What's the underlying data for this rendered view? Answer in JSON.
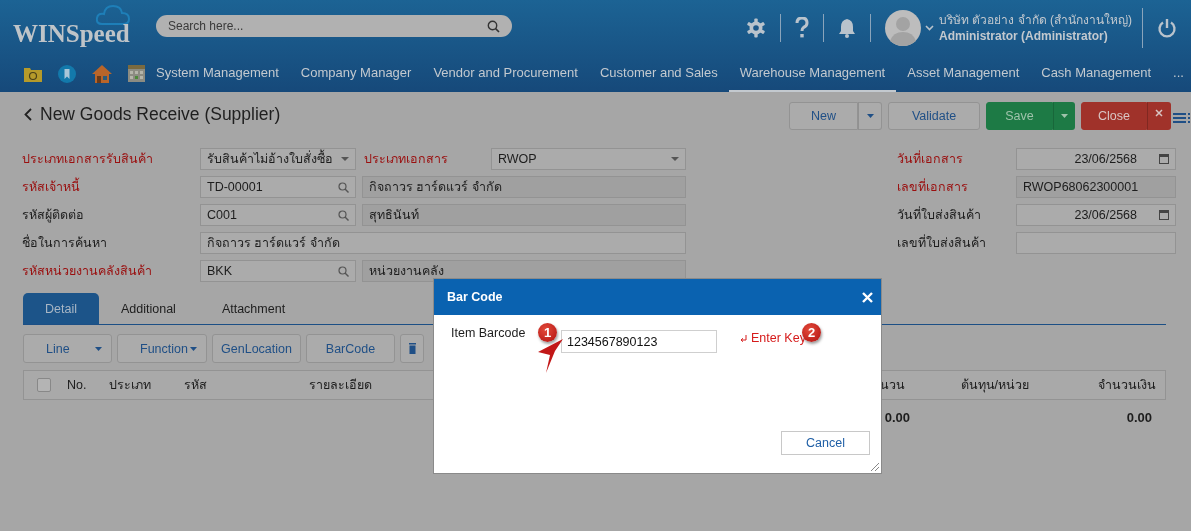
{
  "app": {
    "logo": "WINSpeed",
    "search": {
      "placeholder": "Search here..."
    },
    "user": {
      "company": "บริษัท ตัวอย่าง จำกัด (สำนักงานใหญ่)",
      "name": "Administrator (Administrator)"
    }
  },
  "nav": [
    {
      "label": "System Management",
      "selected": false
    },
    {
      "label": "Company Manager",
      "selected": false
    },
    {
      "label": "Vendor and Procurement",
      "selected": false
    },
    {
      "label": "Customer and Sales",
      "selected": false
    },
    {
      "label": "Warehouse Management",
      "selected": true
    },
    {
      "label": "Asset Management",
      "selected": false
    },
    {
      "label": "Cash Management",
      "selected": false
    }
  ],
  "nav_more": "...",
  "page": {
    "title": "New Goods Receive (Supplier)"
  },
  "actions": [
    {
      "label": "New",
      "kind": "split"
    },
    {
      "label": "Validate",
      "kind": "plain"
    },
    {
      "label": "Save",
      "kind": "confirm"
    },
    {
      "label": "Close",
      "kind": "closable"
    }
  ],
  "form_left": [
    {
      "label": "ประเภทเอกสารรับสินค้า",
      "required": true,
      "fields": [
        {
          "kind": "select",
          "value": "รับสินค้าไม่อ้างใบสั่งซื้อ"
        },
        {
          "kind": "label",
          "value": "ประเภทเอกสาร",
          "required": true
        },
        {
          "kind": "select",
          "value": "RWOP"
        }
      ]
    },
    {
      "label": "รหัสเจ้าหนี้",
      "required": true,
      "fields": [
        {
          "kind": "lookup",
          "value": "TD-00001"
        },
        {
          "kind": "readonly",
          "value": "กิจถาวร ฮาร์ดแวร์ จำกัด"
        }
      ]
    },
    {
      "label": "รหัสผู้ติดต่อ",
      "required": false,
      "fields": [
        {
          "kind": "lookup",
          "value": "C001"
        },
        {
          "kind": "readonly",
          "value": "สุทธินันท์"
        }
      ]
    },
    {
      "label": "ชื่อในการค้นหา",
      "required": false,
      "fields": [
        {
          "kind": "text",
          "value": "กิจถาวร ฮาร์ดแวร์ จำกัด"
        }
      ]
    },
    {
      "label": "รหัสหน่วยงานคลังสินค้า",
      "required": true,
      "fields": [
        {
          "kind": "lookup",
          "value": "BKK"
        },
        {
          "kind": "readonly",
          "value": "หน่วยงานคลัง"
        }
      ]
    }
  ],
  "form_right": [
    {
      "label": "วันที่เอกสาร",
      "required": true,
      "kind": "date",
      "value": "23/06/2568"
    },
    {
      "label": "เลขที่เอกสาร",
      "required": true,
      "kind": "readonly",
      "value": "RWOP68062300001"
    },
    {
      "label": "วันที่ใบส่งสินค้า",
      "required": false,
      "kind": "date",
      "value": "23/06/2568"
    },
    {
      "label": "เลขที่ใบส่งสินค้า",
      "required": false,
      "kind": "text"
    }
  ],
  "tabs": [
    {
      "label": "Detail",
      "selected": true
    },
    {
      "label": "Additional",
      "selected": false
    },
    {
      "label": "Attachment",
      "selected": false
    }
  ],
  "toolbar": [
    {
      "label": "Line",
      "kind": "split"
    },
    {
      "label": "Function",
      "kind": "split"
    },
    {
      "label": "GenLocation",
      "kind": "plain"
    },
    {
      "label": "BarCode",
      "kind": "plain"
    },
    {
      "kind": "icon"
    }
  ],
  "table": {
    "select_all": {
      "checked": false
    },
    "columns": [
      "No.",
      "ประเภท",
      "รหัส",
      "รายละเอียด",
      "นวน",
      "ต้นทุน/หน่วย",
      "จำนวนเงิน"
    ],
    "quantity_total": "0.00",
    "amount_total": "0.00"
  },
  "dialog": {
    "title": "Bar Code",
    "field": {
      "label": "Item Barcode",
      "value": "1234567890123",
      "callout": "1"
    },
    "hint": {
      "text": "Enter Key",
      "callout": "2"
    },
    "cancel": "Cancel"
  }
}
